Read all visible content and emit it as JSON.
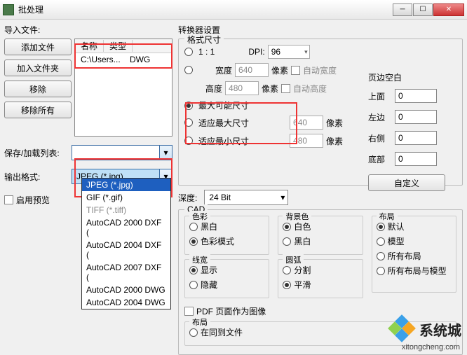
{
  "window": {
    "title": "批处理"
  },
  "left": {
    "import_label": "导入文件:",
    "buttons": {
      "add_file": "添加文件",
      "add_folder": "加入文件夹",
      "remove": "移除",
      "remove_all": "移除所有"
    },
    "file_list": {
      "col_name": "名称",
      "col_type": "类型",
      "rows": [
        {
          "name": "C:\\Users...",
          "type": "DWG"
        }
      ]
    },
    "save_load_label": "保存/加载列表:",
    "output_format_label": "输出格式:",
    "output_format_value": "JPEG (*.jpg)",
    "dropdown_options": [
      "JPEG (*.jpg)",
      "GIF (*.gif)",
      "TIFF (*.tiff)",
      "AutoCAD 2000 DXF (",
      "AutoCAD 2004 DXF (",
      "AutoCAD 2007 DXF (",
      "AutoCAD 2000 DWG",
      "AutoCAD 2004 DWG"
    ],
    "enable_preview": "启用预览"
  },
  "converter": {
    "title": "转换器设置",
    "format_size": {
      "title": "格式尺寸",
      "one_to_one": "1 : 1",
      "dpi_label": "DPI:",
      "dpi_value": "96",
      "width_label": "宽度",
      "width_value": "640",
      "px1": "像素",
      "auto_width": "自动宽度",
      "height_label": "高度",
      "height_value": "480",
      "px2": "像素",
      "auto_height": "自动高度",
      "max_possible": "最大可能尺寸",
      "fit_max": "适应最大尺寸",
      "fit_max_val": "640",
      "px3": "像素",
      "fit_min": "适应最小尺寸",
      "fit_min_val": "480",
      "px4": "像素"
    },
    "depth_label": "深度:",
    "depth_value": "24 Bit",
    "margins": {
      "title": "页边空白",
      "top": "上面",
      "top_v": "0",
      "left": "左边",
      "left_v": "0",
      "right": "右侧",
      "right_v": "0",
      "bottom": "底部",
      "bottom_v": "0",
      "custom": "自定义"
    },
    "cad": {
      "title": "CAD",
      "color": {
        "title": "色彩",
        "bw": "黑白",
        "color_mode": "色彩模式"
      },
      "bg": {
        "title": "背景色",
        "white": "白色",
        "black": "黑白"
      },
      "layout": {
        "title": "布局",
        "default": "默认",
        "model": "模型",
        "all": "所有布局",
        "all_model": "所有布局与模型"
      },
      "linewidth": {
        "title": "线宽",
        "show": "显示",
        "hide": "隐藏"
      },
      "arc": {
        "title": "圆弧",
        "segment": "分割",
        "smooth": "平滑"
      },
      "pdf_as_image": "PDF 页面作为图像",
      "layout2": "布局",
      "save_to_file": "在同到文件"
    }
  },
  "watermark": {
    "text": "系统城",
    "url": "xitongcheng.com"
  }
}
